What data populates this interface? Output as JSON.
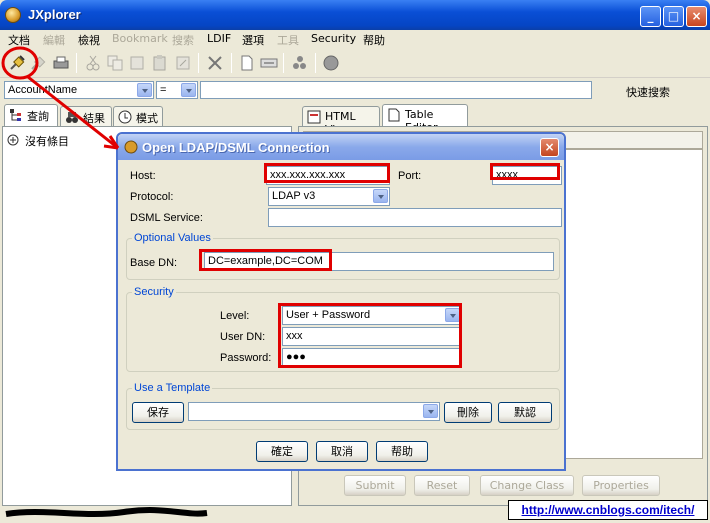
{
  "window": {
    "title": "JXplorer"
  },
  "menu": [
    {
      "label": "文档",
      "enabled": true
    },
    {
      "label": "編輯",
      "enabled": false
    },
    {
      "label": "檢視",
      "enabled": true
    },
    {
      "label": "Bookmark",
      "enabled": false
    },
    {
      "label": "搜索",
      "enabled": false
    },
    {
      "label": "LDIF",
      "enabled": true
    },
    {
      "label": "選項",
      "enabled": true
    },
    {
      "label": "工具",
      "enabled": false
    },
    {
      "label": "Security",
      "enabled": true
    },
    {
      "label": "帮助",
      "enabled": true
    }
  ],
  "search": {
    "attribute": "AccountName",
    "operator": "=",
    "value": "",
    "quick_search_label": "快速搜索"
  },
  "left_tabs": [
    "查詢",
    "結果",
    "模式"
  ],
  "tree": {
    "root_label": "沒有條目"
  },
  "right_tabs": [
    "HTML View",
    "Table Editor"
  ],
  "bottom_buttons": [
    "Submit",
    "Reset",
    "Change Class",
    "Properties"
  ],
  "dialog": {
    "title": "Open LDAP/DSML Connection",
    "host_label": "Host:",
    "host_value": "xxx.xxx.xxx.xxx",
    "port_label": "Port:",
    "port_value": "xxxx",
    "protocol_label": "Protocol:",
    "protocol_value": "LDAP v3",
    "dsml_label": "DSML Service:",
    "dsml_value": "",
    "optional_title": "Optional Values",
    "basedn_label": "Base DN:",
    "basedn_value": "DC=example,DC=COM",
    "security_title": "Security",
    "level_label": "Level:",
    "level_value": "User + Password",
    "userdn_label": "User DN:",
    "userdn_value": "xxx",
    "password_label": "Password:",
    "password_value": "●●●",
    "template_title": "Use a Template",
    "save_label": "保存",
    "template_value": "",
    "delete_label": "刪除",
    "default_label": "默認",
    "ok_label": "確定",
    "cancel_label": "取消",
    "help_label": "帮助"
  },
  "footer_url": "http://www.cnblogs.com/itech/",
  "colors": {
    "annotation": "#e00000",
    "accent": "#0a4fd6"
  }
}
